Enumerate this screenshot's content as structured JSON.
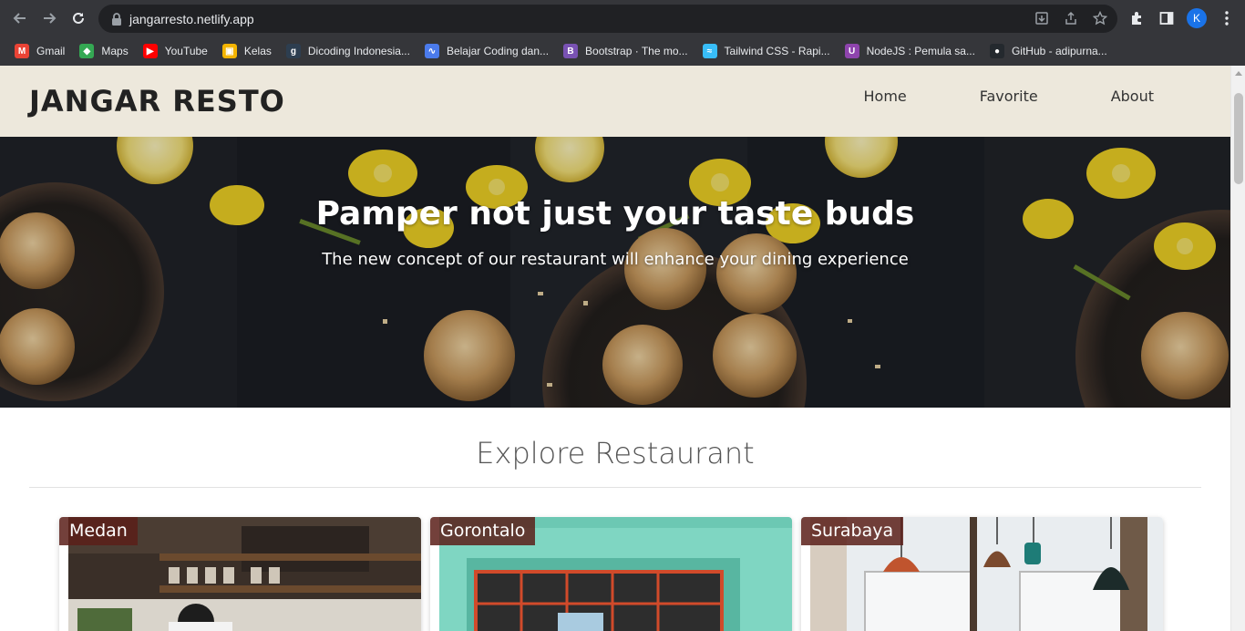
{
  "browser": {
    "url": "jangarresto.netlify.app",
    "avatar_letter": "K",
    "bookmarks": [
      {
        "label": "Gmail",
        "icon": "gmail-icon",
        "color": "#ea4335"
      },
      {
        "label": "Maps",
        "icon": "maps-icon",
        "color": "#34a853"
      },
      {
        "label": "YouTube",
        "icon": "youtube-icon",
        "color": "#ff0000"
      },
      {
        "label": "Kelas",
        "icon": "classroom-icon",
        "color": "#f4b400"
      },
      {
        "label": "Dicoding Indonesia...",
        "icon": "dicoding-icon",
        "color": "#2d3e50"
      },
      {
        "label": "Belajar Coding dan...",
        "icon": "codepolitan-icon",
        "color": "#4b7bec"
      },
      {
        "label": "Bootstrap · The mo...",
        "icon": "bootstrap-icon",
        "color": "#7952b3"
      },
      {
        "label": "Tailwind CSS - Rapi...",
        "icon": "tailwind-icon",
        "color": "#38bdf8"
      },
      {
        "label": "NodeJS : Pemula sa...",
        "icon": "nodejs-course-icon",
        "color": "#8e44ad"
      },
      {
        "label": "GitHub - adipurna...",
        "icon": "github-icon",
        "color": "#24292e"
      }
    ]
  },
  "site": {
    "brand": "JANGAR RESTO",
    "nav": [
      "Home",
      "Favorite",
      "About"
    ],
    "hero": {
      "title": "Pamper not just your taste buds",
      "subtitle": "The new concept of our restaurant will enhance your dining experience"
    },
    "explore_title": "Explore Restaurant",
    "restaurants": [
      {
        "city": "Medan"
      },
      {
        "city": "Gorontalo"
      },
      {
        "city": "Surabaya"
      }
    ]
  },
  "colors": {
    "header_bg": "#ede8dc",
    "city_badge": "#5a1e19",
    "chrome_bg": "#35363a"
  }
}
